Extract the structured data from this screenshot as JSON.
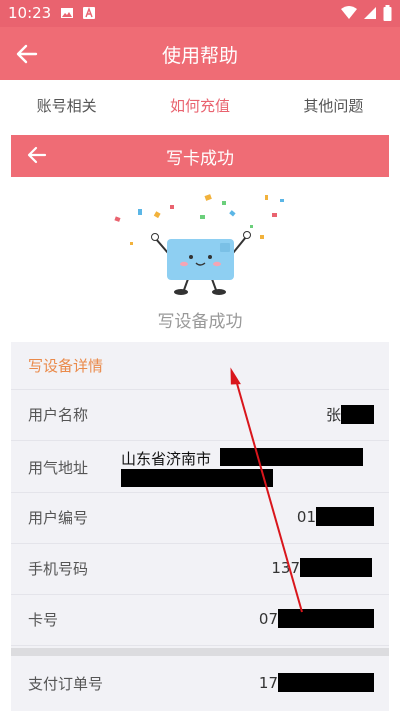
{
  "status": {
    "time": "10:23"
  },
  "app_bar": {
    "title": "使用帮助"
  },
  "tabs": [
    {
      "label": "账号相关",
      "active": false
    },
    {
      "label": "如何充值",
      "active": true
    },
    {
      "label": "其他问题",
      "active": false
    }
  ],
  "inner_bar": {
    "title": "写卡成功"
  },
  "success": {
    "message": "写设备成功"
  },
  "details": {
    "header": "写设备详情",
    "rows": [
      {
        "label": "用户名称",
        "value_prefix": "张"
      },
      {
        "label": "用气地址",
        "value_prefix": "山东省济南市"
      },
      {
        "label": "用户编号",
        "value_prefix": "01"
      },
      {
        "label": "手机号码",
        "value_prefix": "137"
      },
      {
        "label": "卡号",
        "value_prefix": "07"
      },
      {
        "label": "支付订单号",
        "value_prefix": "17"
      }
    ]
  },
  "colors": {
    "brand": "#ef6c75",
    "status_bar": "#e9636f",
    "active_tab": "#e9636f",
    "section_header": "#ea8a4a",
    "annotation_arrow": "#d9161c"
  }
}
